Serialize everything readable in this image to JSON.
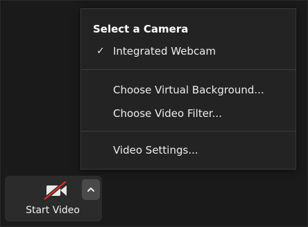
{
  "menu": {
    "title": "Select a Camera",
    "items": [
      {
        "label": "Integrated Webcam",
        "checked": true
      },
      {
        "label": "Choose Virtual Background..."
      },
      {
        "label": "Choose Video Filter..."
      },
      {
        "label": "Video Settings..."
      }
    ]
  },
  "toolbar": {
    "start_video_label": "Start Video",
    "camera_icon": "video-camera-off-icon",
    "slash_color": "#e0301e",
    "caret_icon": "chevron-up-icon"
  }
}
